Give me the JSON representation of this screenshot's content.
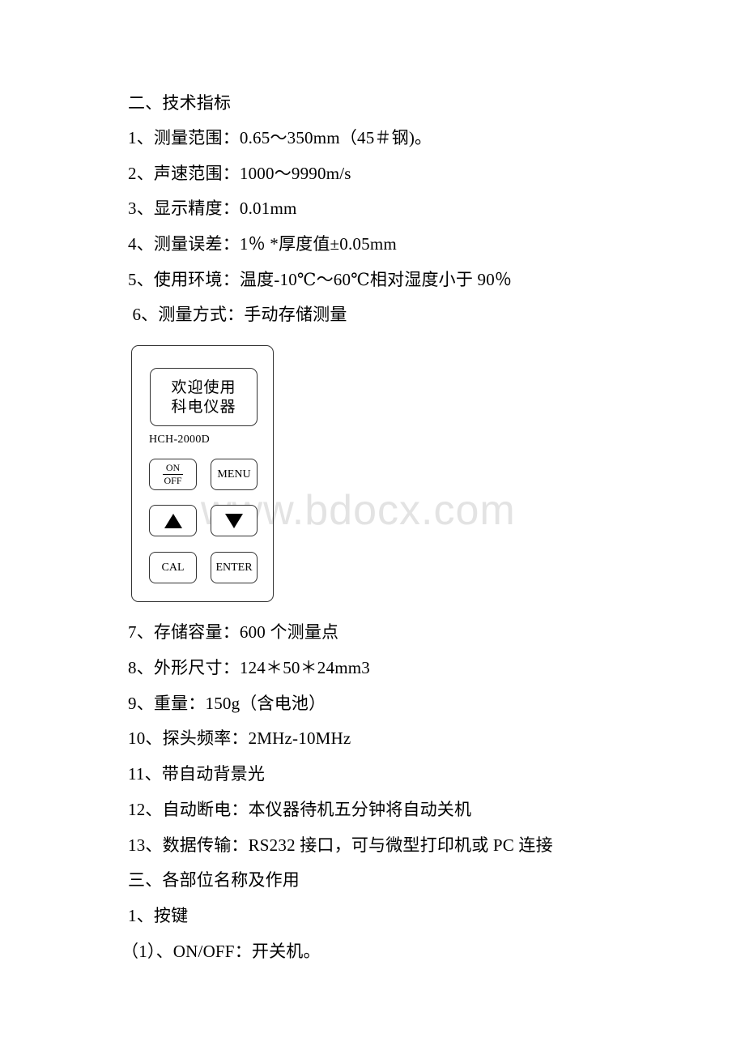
{
  "section2": {
    "heading": "二、技术指标",
    "items": [
      "1、测量范围：0.65～350mm（45＃钢)。",
      "2、声速范围：1000～9990m/s",
      "3、显示精度：0.01mm",
      "4、测量误差：1％ *厚度值±0.05mm",
      "5、使用环境：温度-10℃～60℃相对湿度小于 90％",
      " 6、测量方式：手动存储测量"
    ]
  },
  "device": {
    "screen_line1": "欢迎使用",
    "screen_line2": "科电仪器",
    "model": "HCH-2000D",
    "keys": {
      "on_label": "ON",
      "off_label": "OFF",
      "menu": "MENU",
      "up_icon": "up-arrow-icon",
      "down_icon": "down-arrow-icon",
      "cal": "CAL",
      "enter": "ENTER"
    }
  },
  "watermark": "www.bdocx.com",
  "section2_cont": {
    "items": [
      "7、存储容量：600 个测量点",
      "8、外形尺寸：124＊50＊24mm3",
      "9、重量：150g（含电池）",
      "10、探头频率：2MHz-10MHz",
      "11、带自动背景光",
      "12、自动断电：本仪器待机五分钟将自动关机",
      "13、数据传输：RS232 接口，可与微型打印机或 PC 连接"
    ]
  },
  "section3": {
    "heading": "三、各部位名称及作用",
    "sub_heading": "1、按键",
    "items": [
      "（1）、ON/OFF：开关机。"
    ]
  }
}
